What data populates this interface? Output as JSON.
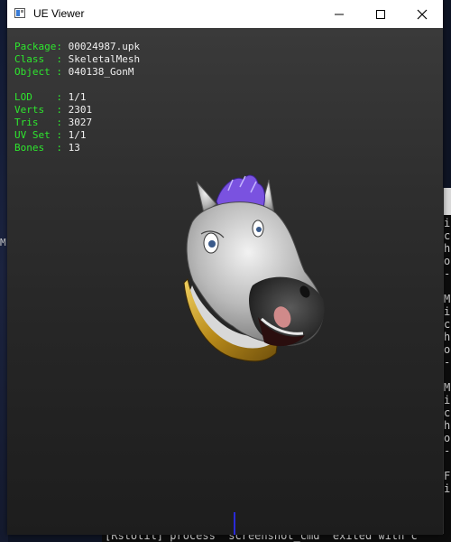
{
  "window": {
    "title": "UE Viewer"
  },
  "info": {
    "lines": [
      {
        "label": "Package: ",
        "value": "00024987.upk"
      },
      {
        "label": "Class  : ",
        "value": "SkeletalMesh"
      },
      {
        "label": "Object : ",
        "value": "040138_GonM"
      },
      null,
      {
        "label": "LOD    : ",
        "value": "1/1"
      },
      {
        "label": "Verts  : ",
        "value": "2301"
      },
      {
        "label": "Tris   : ",
        "value": "3027"
      },
      {
        "label": "UV Set : ",
        "value": "1/1"
      },
      {
        "label": "Bones  : ",
        "value": "13"
      }
    ]
  },
  "background_terminal": {
    "left_fragment": "M",
    "right_column": [
      "i",
      "c",
      "h",
      "o",
      "-",
      "",
      "M",
      "i",
      "c",
      "h",
      "o",
      "-",
      "",
      "M",
      "i",
      "c",
      "h",
      "o",
      "-",
      "",
      "F",
      "i"
    ],
    "bottom_text": "[RstUtil] process \"screenshot_cmd\" exited with c"
  },
  "colors": {
    "label_green": "#2ee62e",
    "value_white": "#f0f0f0",
    "mane_purple": "#7a52e0",
    "collar_gold": "#c9a227"
  },
  "icons": [
    "app-icon",
    "minimize-icon",
    "maximize-icon",
    "close-icon"
  ]
}
